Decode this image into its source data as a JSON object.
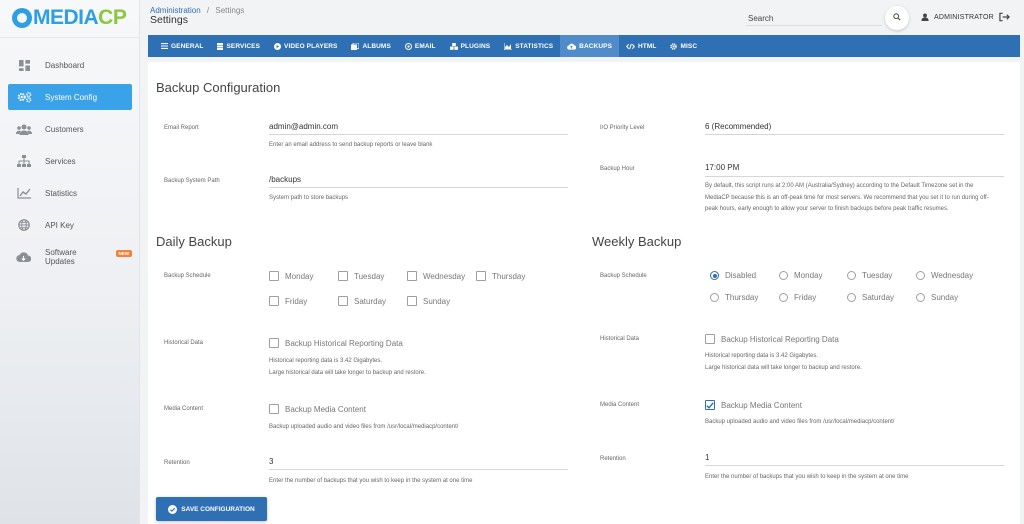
{
  "brand": {
    "logo_main": "MEDIA",
    "logo_accent": "CP"
  },
  "sidebar": {
    "items": [
      {
        "label": "Dashboard",
        "icon": "dashboard-icon"
      },
      {
        "label": "System Config",
        "icon": "gears-icon",
        "active": true
      },
      {
        "label": "Customers",
        "icon": "users-icon"
      },
      {
        "label": "Services",
        "icon": "sitemap-icon"
      },
      {
        "label": "Statistics",
        "icon": "chart-line-icon"
      },
      {
        "label": "API Key",
        "icon": "globe-icon"
      },
      {
        "label": "Software Updates",
        "icon": "cloud-download-icon",
        "badge": "NEW"
      }
    ]
  },
  "header": {
    "breadcrumb_link": "Administration",
    "breadcrumb_sep": "/",
    "breadcrumb_current": "Settings",
    "title": "Settings",
    "search_label": "Search",
    "user_name": "ADMINISTRATOR"
  },
  "tabs": [
    {
      "label": "GENERAL",
      "icon": "bars-icon"
    },
    {
      "label": "SERVICES",
      "icon": "server-icon"
    },
    {
      "label": "VIDEO PLAYERS",
      "icon": "play-circle-icon"
    },
    {
      "label": "ALBUMS",
      "icon": "albums-icon"
    },
    {
      "label": "EMAIL",
      "icon": "at-icon"
    },
    {
      "label": "PLUGINS",
      "icon": "cubes-icon"
    },
    {
      "label": "STATISTICS",
      "icon": "area-chart-icon"
    },
    {
      "label": "BACKUPS",
      "icon": "cloud-upload-icon",
      "active": true
    },
    {
      "label": "HTML",
      "icon": "code-icon"
    },
    {
      "label": "MISC",
      "icon": "gear-icon"
    }
  ],
  "backup_config": {
    "title": "Backup Configuration",
    "email_label": "Email Report",
    "email_value": "admin@admin.com",
    "email_help": "Enter an email address to send backup reports or leave blank",
    "path_label": "Backup System Path",
    "path_value": "/backups",
    "path_help": "System path to store backups",
    "io_label": "I/O Priority Level",
    "io_value": "6 (Recommended)",
    "hour_label": "Backup Hour",
    "hour_value": "17:00 PM",
    "hour_help_1": "By default, this script runs at 2:00 AM (Australia/Sydney) according to the Default Timezone set in the",
    "hour_help_2": "MediaCP because this is an off-peak time for most servers. We recommend that you set it to run during off-",
    "hour_help_3": "peak hours, early enough to allow your server to finish backups before peak traffic resumes."
  },
  "daily": {
    "title": "Daily Backup",
    "schedule_label": "Backup Schedule",
    "days": [
      {
        "label": "Monday",
        "checked": false
      },
      {
        "label": "Tuesday",
        "checked": false
      },
      {
        "label": "Wednesday",
        "checked": false
      },
      {
        "label": "Thursday",
        "checked": false
      },
      {
        "label": "Friday",
        "checked": false
      },
      {
        "label": "Saturday",
        "checked": false
      },
      {
        "label": "Sunday",
        "checked": false
      }
    ],
    "history_label": "Historical Data",
    "history_checkbox": "Backup Historical Reporting Data",
    "history_checked": false,
    "history_help_1": "Historical reporting data is 3.42 Gigabytes.",
    "history_help_2": "Large historical data will take longer to backup and restore.",
    "media_label": "Media Content",
    "media_checkbox": "Backup Media Content",
    "media_checked": false,
    "media_help": "Backup uploaded audio and video files from /usr/local/mediacp/content/",
    "retention_label": "Retention",
    "retention_value": "3",
    "retention_help": "Enter the number of backups that you wish to keep in the system at one time"
  },
  "weekly": {
    "title": "Weekly Backup",
    "schedule_label": "Backup Schedule",
    "options": [
      {
        "label": "Disabled",
        "selected": true
      },
      {
        "label": "Monday",
        "selected": false
      },
      {
        "label": "Tuesday",
        "selected": false
      },
      {
        "label": "Wednesday",
        "selected": false
      },
      {
        "label": "Thursday",
        "selected": false
      },
      {
        "label": "Friday",
        "selected": false
      },
      {
        "label": "Saturday",
        "selected": false
      },
      {
        "label": "Sunday",
        "selected": false
      }
    ],
    "history_label": "Historical Data",
    "history_checkbox": "Backup Historical Reporting Data",
    "history_checked": false,
    "history_help_1": "Historical reporting data is 3.42 Gigabytes.",
    "history_help_2": "Large historical data will take longer to backup and restore.",
    "media_label": "Media Content",
    "media_checkbox": "Backup Media Content",
    "media_checked": true,
    "media_help": "Backup uploaded audio and video files from /usr/local/mediacp/content/",
    "retention_label": "Retention",
    "retention_value": "1",
    "retention_help": "Enter the number of backups that you wish to keep in the system at one time"
  },
  "actions": {
    "save_label": "SAVE CONFIGURATION"
  },
  "colors": {
    "primary": "#2f6fb3",
    "accent": "#3aa2e8",
    "brand_green": "#8cc63f",
    "badge": "#f0843c"
  }
}
